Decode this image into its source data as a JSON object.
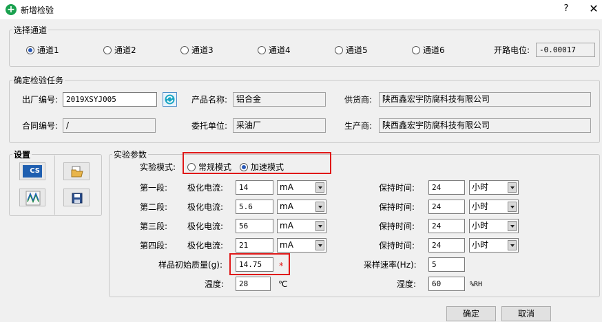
{
  "window": {
    "title": "新增检验",
    "help": "?",
    "close": "✕"
  },
  "channel": {
    "legend": "选择通道",
    "options": [
      "通道1",
      "通道2",
      "通道3",
      "通道4",
      "通道5",
      "通道6"
    ],
    "selected": "通道1",
    "ocv_label": "开路电位:",
    "ocv_value": "-0.00017"
  },
  "task": {
    "legend": "确定检验任务",
    "factory_no_label": "出厂编号:",
    "factory_no": "2019XSYJ005",
    "product_label": "产品名称:",
    "product": "铝合金",
    "supplier_label": "供货商:",
    "supplier": "陕西鑫宏宇防腐科技有限公司",
    "contract_label": "合同编号:",
    "contract": "/",
    "client_label": "委托单位:",
    "client": "采油厂",
    "maker_label": "生产商:",
    "maker": "陕西鑫宏宇防腐科技有限公司"
  },
  "settings": {
    "legend": "设置",
    "tool_icons": [
      "cs-icon",
      "wave-icon",
      "open-folder-icon",
      "save-icon"
    ],
    "cs_text": "CS"
  },
  "params": {
    "legend": "实验参数",
    "mode_label": "实验模式:",
    "modes": [
      "常规模式",
      "加速模式"
    ],
    "selected_mode": "加速模式",
    "current_label": "极化电流:",
    "hold_label": "保持时间:",
    "stages": [
      {
        "name": "第一段:",
        "current": "14",
        "unit": "mA",
        "hold": "24",
        "hold_unit": "小时"
      },
      {
        "name": "第二段:",
        "current": "5.6",
        "unit": "mA",
        "hold": "24",
        "hold_unit": "小时"
      },
      {
        "name": "第三段:",
        "current": "56",
        "unit": "mA",
        "hold": "24",
        "hold_unit": "小时"
      },
      {
        "name": "第四段:",
        "current": "21",
        "unit": "mA",
        "hold": "24",
        "hold_unit": "小时"
      }
    ],
    "mass_label": "样品初始质量(g):",
    "mass": "14.75",
    "required_mark": "*",
    "rate_label": "采样速率(Hz):",
    "rate": "5",
    "temp_label": "温度:",
    "temp": "28",
    "temp_unit": "℃",
    "humidity_label": "湿度:",
    "humidity": "60",
    "humidity_unit": "%RH"
  },
  "buttons": {
    "ok": "确定",
    "cancel": "取消"
  },
  "colors": {
    "highlight": "#e01818",
    "accent": "#1aa14f"
  }
}
